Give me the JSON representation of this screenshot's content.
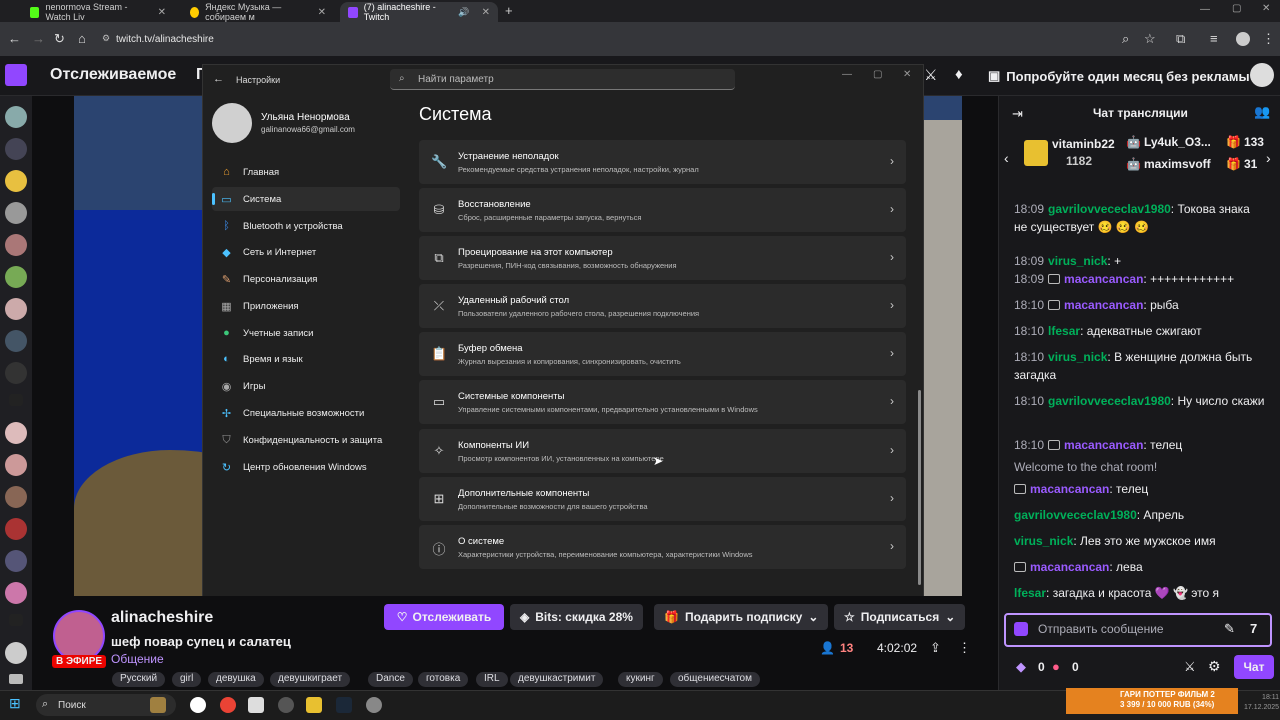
{
  "browser": {
    "tabs": [
      {
        "title": "nenormova Stream - Watch Liv"
      },
      {
        "title": "Яндекс Музыка — собираем м"
      },
      {
        "title": "(7) alinacheshire - Twitch"
      }
    ],
    "new_tab": "+",
    "url": "twitch.tv/alinacheshire"
  },
  "twitch_header": {
    "following": "Отслеживаемое",
    "browse_partial": "П",
    "promo": "Попробуйте один месяц без рекламы"
  },
  "settings": {
    "window_title": "Настройки",
    "search_placeholder": "Найти параметр",
    "profile": {
      "name": "Ульяна Ненормова",
      "email": "galinanowa66@gmail.com"
    },
    "nav": [
      {
        "label": "Главная",
        "icon": "home-icon"
      },
      {
        "label": "Система",
        "icon": "display-icon"
      },
      {
        "label": "Bluetooth и устройства",
        "icon": "bluetooth-icon"
      },
      {
        "label": "Сеть и Интернет",
        "icon": "wifi-icon"
      },
      {
        "label": "Персонализация",
        "icon": "brush-icon"
      },
      {
        "label": "Приложения",
        "icon": "apps-icon"
      },
      {
        "label": "Учетные записи",
        "icon": "person-icon"
      },
      {
        "label": "Время и язык",
        "icon": "globe-clock-icon"
      },
      {
        "label": "Игры",
        "icon": "gamepad-icon"
      },
      {
        "label": "Специальные возможности",
        "icon": "accessibility-icon"
      },
      {
        "label": "Конфиденциальность и защита",
        "icon": "shield-icon"
      },
      {
        "label": "Центр обновления Windows",
        "icon": "update-icon"
      }
    ],
    "page_title": "Система",
    "rows": [
      {
        "title": "Устранение неполадок",
        "desc": "Рекомендуемые средства устранения неполадок, настройки, журнал",
        "icon": "wrench-icon"
      },
      {
        "title": "Восстановление",
        "desc": "Сброс, расширенные параметры запуска, вернуться",
        "icon": "recovery-icon"
      },
      {
        "title": "Проецирование на этот компьютер",
        "desc": "Разрешения, ПИН-код связывания, возможность обнаружения",
        "icon": "project-icon"
      },
      {
        "title": "Удаленный рабочий стол",
        "desc": "Пользователи удаленного рабочего стола, разрешения подключения",
        "icon": "remote-desktop-icon"
      },
      {
        "title": "Буфер обмена",
        "desc": "Журнал вырезания и копирования, синхронизировать, очистить",
        "icon": "clipboard-icon"
      },
      {
        "title": "Системные компоненты",
        "desc": "Управление системными компонентами, предварительно установленными в Windows",
        "icon": "components-icon"
      },
      {
        "title": "Компоненты ИИ",
        "desc": "Просмотр компонентов ИИ, установленных на компьютере",
        "icon": "sparkle-icon"
      },
      {
        "title": "Дополнительные компоненты",
        "desc": "Дополнительные возможности для вашего устройства",
        "icon": "add-grid-icon"
      },
      {
        "title": "О системе",
        "desc": "Характеристики устройства, переименование компьютера, характеристики Windows",
        "icon": "info-icon"
      }
    ]
  },
  "chat": {
    "title": "Чат трансляции",
    "gifters": [
      {
        "name": "vitaminb22",
        "count": "1182"
      },
      {
        "name": "Ly4uk_O3...",
        "count": "133"
      },
      {
        "name": "maximsvoff",
        "count": "31"
      }
    ],
    "messages": [
      {
        "time": "18:09",
        "user": "gavrilovvececlav1980",
        "color": "#00b05a",
        "mod": false,
        "text": ": Токова знака не существует 🥴 🥴 🥴"
      },
      {
        "time": "18:09",
        "user": "virus_nick",
        "color": "#00b05a",
        "mod": false,
        "text": ": +"
      },
      {
        "time": "18:09",
        "user": "macancancan",
        "color": "#9a5bff",
        "mod": true,
        "text": ": ++++++++++++"
      },
      {
        "time": "18:10",
        "user": "macancancan",
        "color": "#9a5bff",
        "mod": true,
        "text": ": рыба"
      },
      {
        "time": "18:10",
        "user": "lfesar",
        "color": "#00b05a",
        "mod": false,
        "text": ": адекватные сжигают"
      },
      {
        "time": "18:10",
        "user": "virus_nick",
        "color": "#00b05a",
        "mod": false,
        "text": ": В женщине должна быть загадка"
      },
      {
        "time": "18:10",
        "user": "gavrilovvececlav1980",
        "color": "#00b05a",
        "mod": false,
        "text": ": Ну число скажи"
      },
      {
        "time": "18:10",
        "user": "macancancan",
        "color": "#9a5bff",
        "mod": true,
        "text": ": телец"
      },
      {
        "time": "",
        "user": "",
        "color": "#adadb8",
        "mod": false,
        "text": "Welcome to the chat room!"
      },
      {
        "time": "",
        "user": "macancancan",
        "color": "#9a5bff",
        "mod": true,
        "text": ": телец"
      },
      {
        "time": "",
        "user": "gavrilovvececlav1980",
        "color": "#00b05a",
        "mod": false,
        "text": ": Апрель"
      },
      {
        "time": "",
        "user": "virus_nick",
        "color": "#00b05a",
        "mod": false,
        "text": ": Лев это же мужское имя"
      },
      {
        "time": "",
        "user": "macancancan",
        "color": "#9a5bff",
        "mod": true,
        "text": ": лева"
      },
      {
        "time": "",
        "user": "lfesar",
        "color": "#00b05a",
        "mod": false,
        "text": ": загадка и красота 💜 👻 это я"
      }
    ],
    "input_placeholder": "Отправить сообщение",
    "points": "0",
    "bits": "0",
    "send_label": "Чат"
  },
  "stream": {
    "streamer": "alinacheshire",
    "title": "шеф повар супец и салатец",
    "category": "Общение",
    "live_label": "В ЭФИРЕ",
    "viewers": "13",
    "uptime": "4:02:02",
    "follow_label": "Отслеживать",
    "bits_label": "Bits: скидка 28%",
    "gift_label": "Подарить подписку",
    "subscribe_label": "Подписаться",
    "tags": [
      "Русский",
      "girl",
      "девушка",
      "девушкиграет",
      "Dance",
      "готовка",
      "IRL",
      "девушкастримит",
      "кукинг",
      "общениесчатом"
    ]
  },
  "taskbar": {
    "search": "Поиск",
    "news_title": "ГАРИ ПОТТЕР ФИЛЬМ 2",
    "news_sub": "3 399 / 10 000 RUB (34%)",
    "time": "18:11",
    "date": "17.12.2025"
  },
  "colors": {
    "twitch_purple": "#9147ff",
    "accent_blue": "#4cc2ff",
    "live_red": "#eb0400"
  }
}
